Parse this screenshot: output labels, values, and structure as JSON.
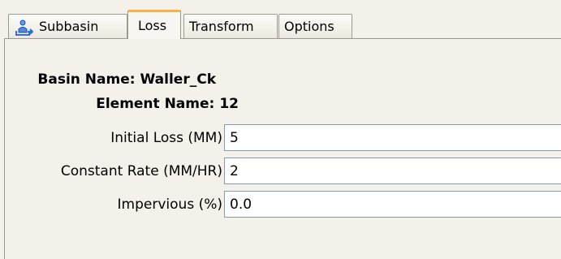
{
  "tabs": [
    {
      "label": "Subbasin",
      "icon": "subbasin-icon",
      "active": false
    },
    {
      "label": "Loss",
      "active": true
    },
    {
      "label": "Transform",
      "active": false
    },
    {
      "label": "Options",
      "active": false
    }
  ],
  "info": {
    "basin_label": "Basin Name:",
    "basin_value": "Waller_Ck",
    "element_label": "Element Name:",
    "element_value": "12"
  },
  "fields": {
    "initial_loss": {
      "label": "Initial Loss (MM)",
      "value": "5"
    },
    "constant_rate": {
      "label": "Constant Rate (MM/HR)",
      "value": "2"
    },
    "impervious": {
      "label": "Impervious (%)",
      "value": "0.0"
    }
  },
  "colors": {
    "background": "#f3f1e9",
    "active_tab_accent": "#f5b34a",
    "input_border": "#7f9db9"
  }
}
